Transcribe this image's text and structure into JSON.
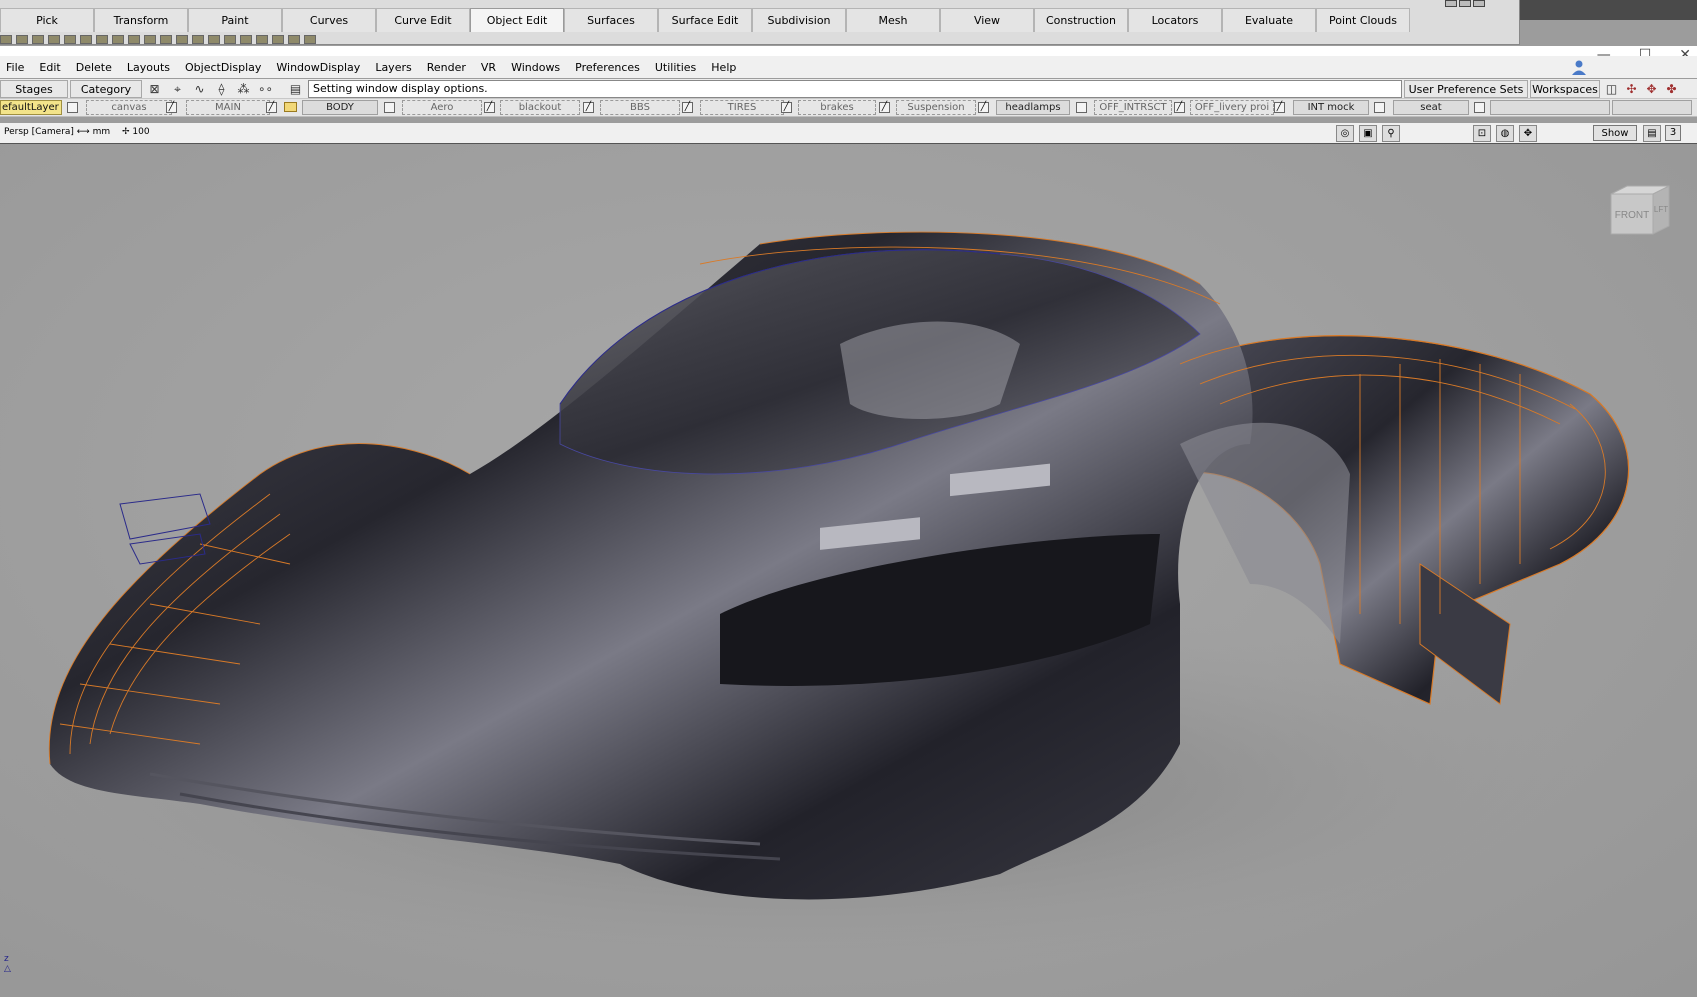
{
  "palette": {
    "tabs": [
      "Pick",
      "Transform",
      "Paint",
      "Curves",
      "Curve Edit",
      "Object Edit",
      "Surfaces",
      "Surface Edit",
      "Subdivision",
      "Mesh",
      "View",
      "Construction",
      "Locators",
      "Evaluate",
      "Point Clouds"
    ],
    "active_tab": "Object Edit"
  },
  "window": {
    "minimize": "—",
    "maximize": "☐",
    "close": "✕"
  },
  "menubar": {
    "items": [
      "File",
      "Edit",
      "Delete",
      "Layouts",
      "ObjectDisplay",
      "WindowDisplay",
      "Layers",
      "Render",
      "VR",
      "Windows",
      "Preferences",
      "Utilities",
      "Help"
    ]
  },
  "statusbar": {
    "stages": "Stages",
    "category": "Category",
    "message": "Setting window display options.",
    "user_pref_sets": "User Preference Sets",
    "workspaces": "Workspaces"
  },
  "layers": {
    "items": [
      "efaultLayer",
      "canvas",
      "MAIN",
      "BODY",
      "Aero",
      "blackout",
      "BBS",
      "TIRES",
      "brakes",
      "Suspension",
      "headlamps",
      "OFF_INTRSCT",
      "OFF_livery proi",
      "INT mock",
      "seat"
    ],
    "default_color": "#f3e48a"
  },
  "viewport": {
    "camera": "Persp [Camera] ⟷ mm",
    "grid": "100",
    "show": "Show",
    "window_number": "3",
    "viewcube_front": "FRONT",
    "viewcube_left": "LFT",
    "axis_label": "z"
  },
  "colors": {
    "wireframe": "#d87a28",
    "body": "#2a2a34",
    "accent_blue": "#2b2b8a"
  }
}
